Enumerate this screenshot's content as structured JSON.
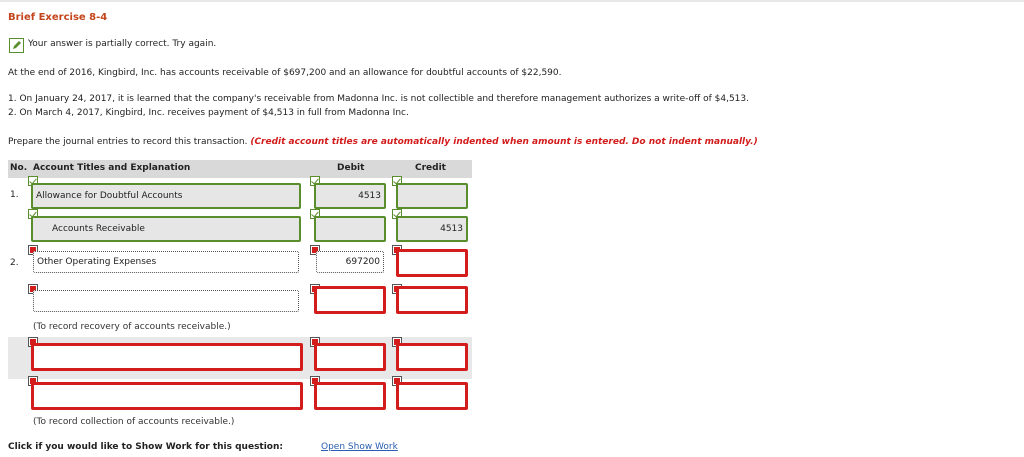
{
  "title": "Brief Exercise 8-4",
  "status": "Your answer is partially correct.  Try again.",
  "problem": "At the end of 2016, Kingbird, Inc. has accounts receivable of $697,200 and an allowance for doubtful accounts of $22,590.",
  "items": [
    "1.  On January 24, 2017, it is learned that the company's receivable from Madonna Inc. is not collectible and therefore management authorizes a write-off of $4,513.",
    "2.  On March 4, 2017, Kingbird, Inc. receives payment of $4,513 in full from Madonna Inc."
  ],
  "instruction": "Prepare the journal entries to record this transaction.",
  "instruction_note": "(Credit account titles are automatically indented when amount is entered. Do not indent manually.)",
  "table": {
    "col_no": "No.",
    "col_account": "Account Titles and Explanation",
    "col_debit": "Debit",
    "col_credit": "Credit"
  },
  "entry1": {
    "num": "1.",
    "row1_account": "Allowance for Doubtful Accounts",
    "row1_debit": "4513",
    "row2_account": "Accounts Receivable",
    "row2_credit": "4513"
  },
  "entry2": {
    "num": "2.",
    "row1_account": "Other Operating Expenses",
    "row1_debit": "697200",
    "note1": "(To record recovery of accounts receivable.)",
    "note2": "(To record collection of accounts receivable.)"
  },
  "footer": {
    "prompt": "Click if you would like to Show Work for this question:",
    "link": "Open Show Work"
  },
  "colors": {
    "title": "#c4451c",
    "correct": "#5a8d2c",
    "incorrect": "#d31c1c",
    "link": "#2a5db0"
  }
}
